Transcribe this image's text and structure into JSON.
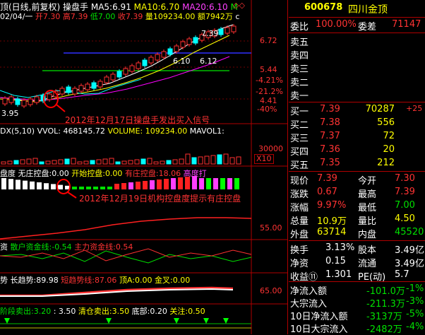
{
  "top_header": {
    "left_a": "顶(日线,前复权)",
    "left_b": "操盘手",
    "ma5_label": "MA5:",
    "ma5": "6.91",
    "ma10_label": "MA10:",
    "ma10": "6.70",
    "ma20_label": "MA20:",
    "ma20": "6.10",
    "ma_more": "M",
    "diamond_glyph": "◇◇",
    "line2_date": "02/04/一",
    "line2_open": "开7.30",
    "line2_high": "高7.39",
    "line2_low": "低7.00",
    "line2_close": "收7.39",
    "line2_vol": "量109234.00",
    "line2_amt": "额7942万",
    "line2_more": "c"
  },
  "price_axis": [
    "6.72",
    "5.44",
    "4.41",
    "3.95"
  ],
  "pct_axis": [
    "-4.21%",
    "-21.2%",
    "-40%"
  ],
  "price_marks": {
    "high": "7.39",
    "mid1": "6.10",
    "mid2": "6.12"
  },
  "annotation1": "2012年12月17日操盘手发出买入信号",
  "vol_header": {
    "a": "DX(5,10)",
    "vvol": "VVOL: 468145.72",
    "volume": "VOLUME: 109234.00",
    "mavol": "MAVOL1:"
  },
  "vol_axis": {
    "v": "30000",
    "unit": "X10"
  },
  "ctrl_header": {
    "title": "盘度",
    "none_label": "无庄控盘:",
    "none_val": "0.00",
    "start_label": "开始控盘:",
    "start_val": "0.00",
    "has_label": "有庄控盘:",
    "has_val": "18.06",
    "high_label": "高度打"
  },
  "annotation2": "2012年12月19日机构控盘度提示有庄控盘",
  "ctrl_axis": "55.00",
  "fund_header": {
    "a": "资",
    "retail_label": "散户资金线:",
    "retail_val": "-0.54",
    "main_label": "主力资金线:",
    "main_val": "0.54"
  },
  "trend_header": {
    "a": "势",
    "long_label": "长趋势:",
    "long_val": "89.98",
    "short_label": "短趋势线:",
    "short_val": "87.06",
    "top_label": "顶A:",
    "top_val": "0.00",
    "gold_label": "金叉:",
    "gold_val": "0.00"
  },
  "trend_axis": "65.00",
  "bottom_header": {
    "stage_label": "阶段卖出:",
    "stage_val": "3.20",
    "stage_val2": ": 3.50",
    "clear_label": "清仓卖出:",
    "clear_val": "3.50",
    "bottom_label": "底部:",
    "bottom_val": "0.20",
    "watch_label": "关注:",
    "watch_val": "0.50"
  },
  "panel": {
    "code": "600678",
    "name": "四川金顶",
    "wb_label": "委比",
    "wb_val": "100.00%",
    "wc_label": "委差",
    "wc_val": "71147",
    "sells": [
      "卖五",
      "卖四",
      "卖三",
      "卖二",
      "卖一"
    ],
    "buys": [
      {
        "label": "买一",
        "price": "7.39",
        "vol": "70287",
        "chg": "+25"
      },
      {
        "label": "买二",
        "price": "7.38",
        "vol": "556",
        "chg": ""
      },
      {
        "label": "买三",
        "price": "7.37",
        "vol": "72",
        "chg": ""
      },
      {
        "label": "买四",
        "price": "7.36",
        "vol": "20",
        "chg": ""
      },
      {
        "label": "买五",
        "price": "7.35",
        "vol": "212",
        "chg": ""
      }
    ],
    "quote": [
      {
        "l1": "现价",
        "v1": "7.39",
        "l2": "今开",
        "v2": "7.30"
      },
      {
        "l1": "涨跌",
        "v1": "0.67",
        "l2": "最高",
        "v2": "7.39"
      },
      {
        "l1": "涨幅",
        "v1": "9.97%",
        "l2": "最低",
        "v2": "7.00"
      },
      {
        "l1": "总量",
        "v1": "10.9万",
        "l2": "量比",
        "v2": "4.50"
      },
      {
        "l1": "外盘",
        "v1": "63714",
        "l2": "内盘",
        "v2": "45520"
      }
    ],
    "stats": [
      {
        "l1": "换手",
        "v1": "3.13%",
        "l2": "股本",
        "v2": "3.49亿"
      },
      {
        "l1": "净资",
        "v1": "0.15",
        "l2": "流通",
        "v2": "3.49亿"
      },
      {
        "l1": "收益⑪",
        "v1": "1.301",
        "l2": "PE(动)",
        "v2": "5.7"
      }
    ],
    "flows": [
      {
        "label": "净流入额",
        "val": "-101.0万",
        "pct": "-1%"
      },
      {
        "label": "大宗流入",
        "val": "-211.3万",
        "pct": "-3%"
      },
      {
        "label": "10日净流入额",
        "val": "-3137万",
        "pct": "-5%"
      },
      {
        "label": "10日大宗流入",
        "val": "-2482万",
        "pct": "-4%"
      }
    ]
  }
}
